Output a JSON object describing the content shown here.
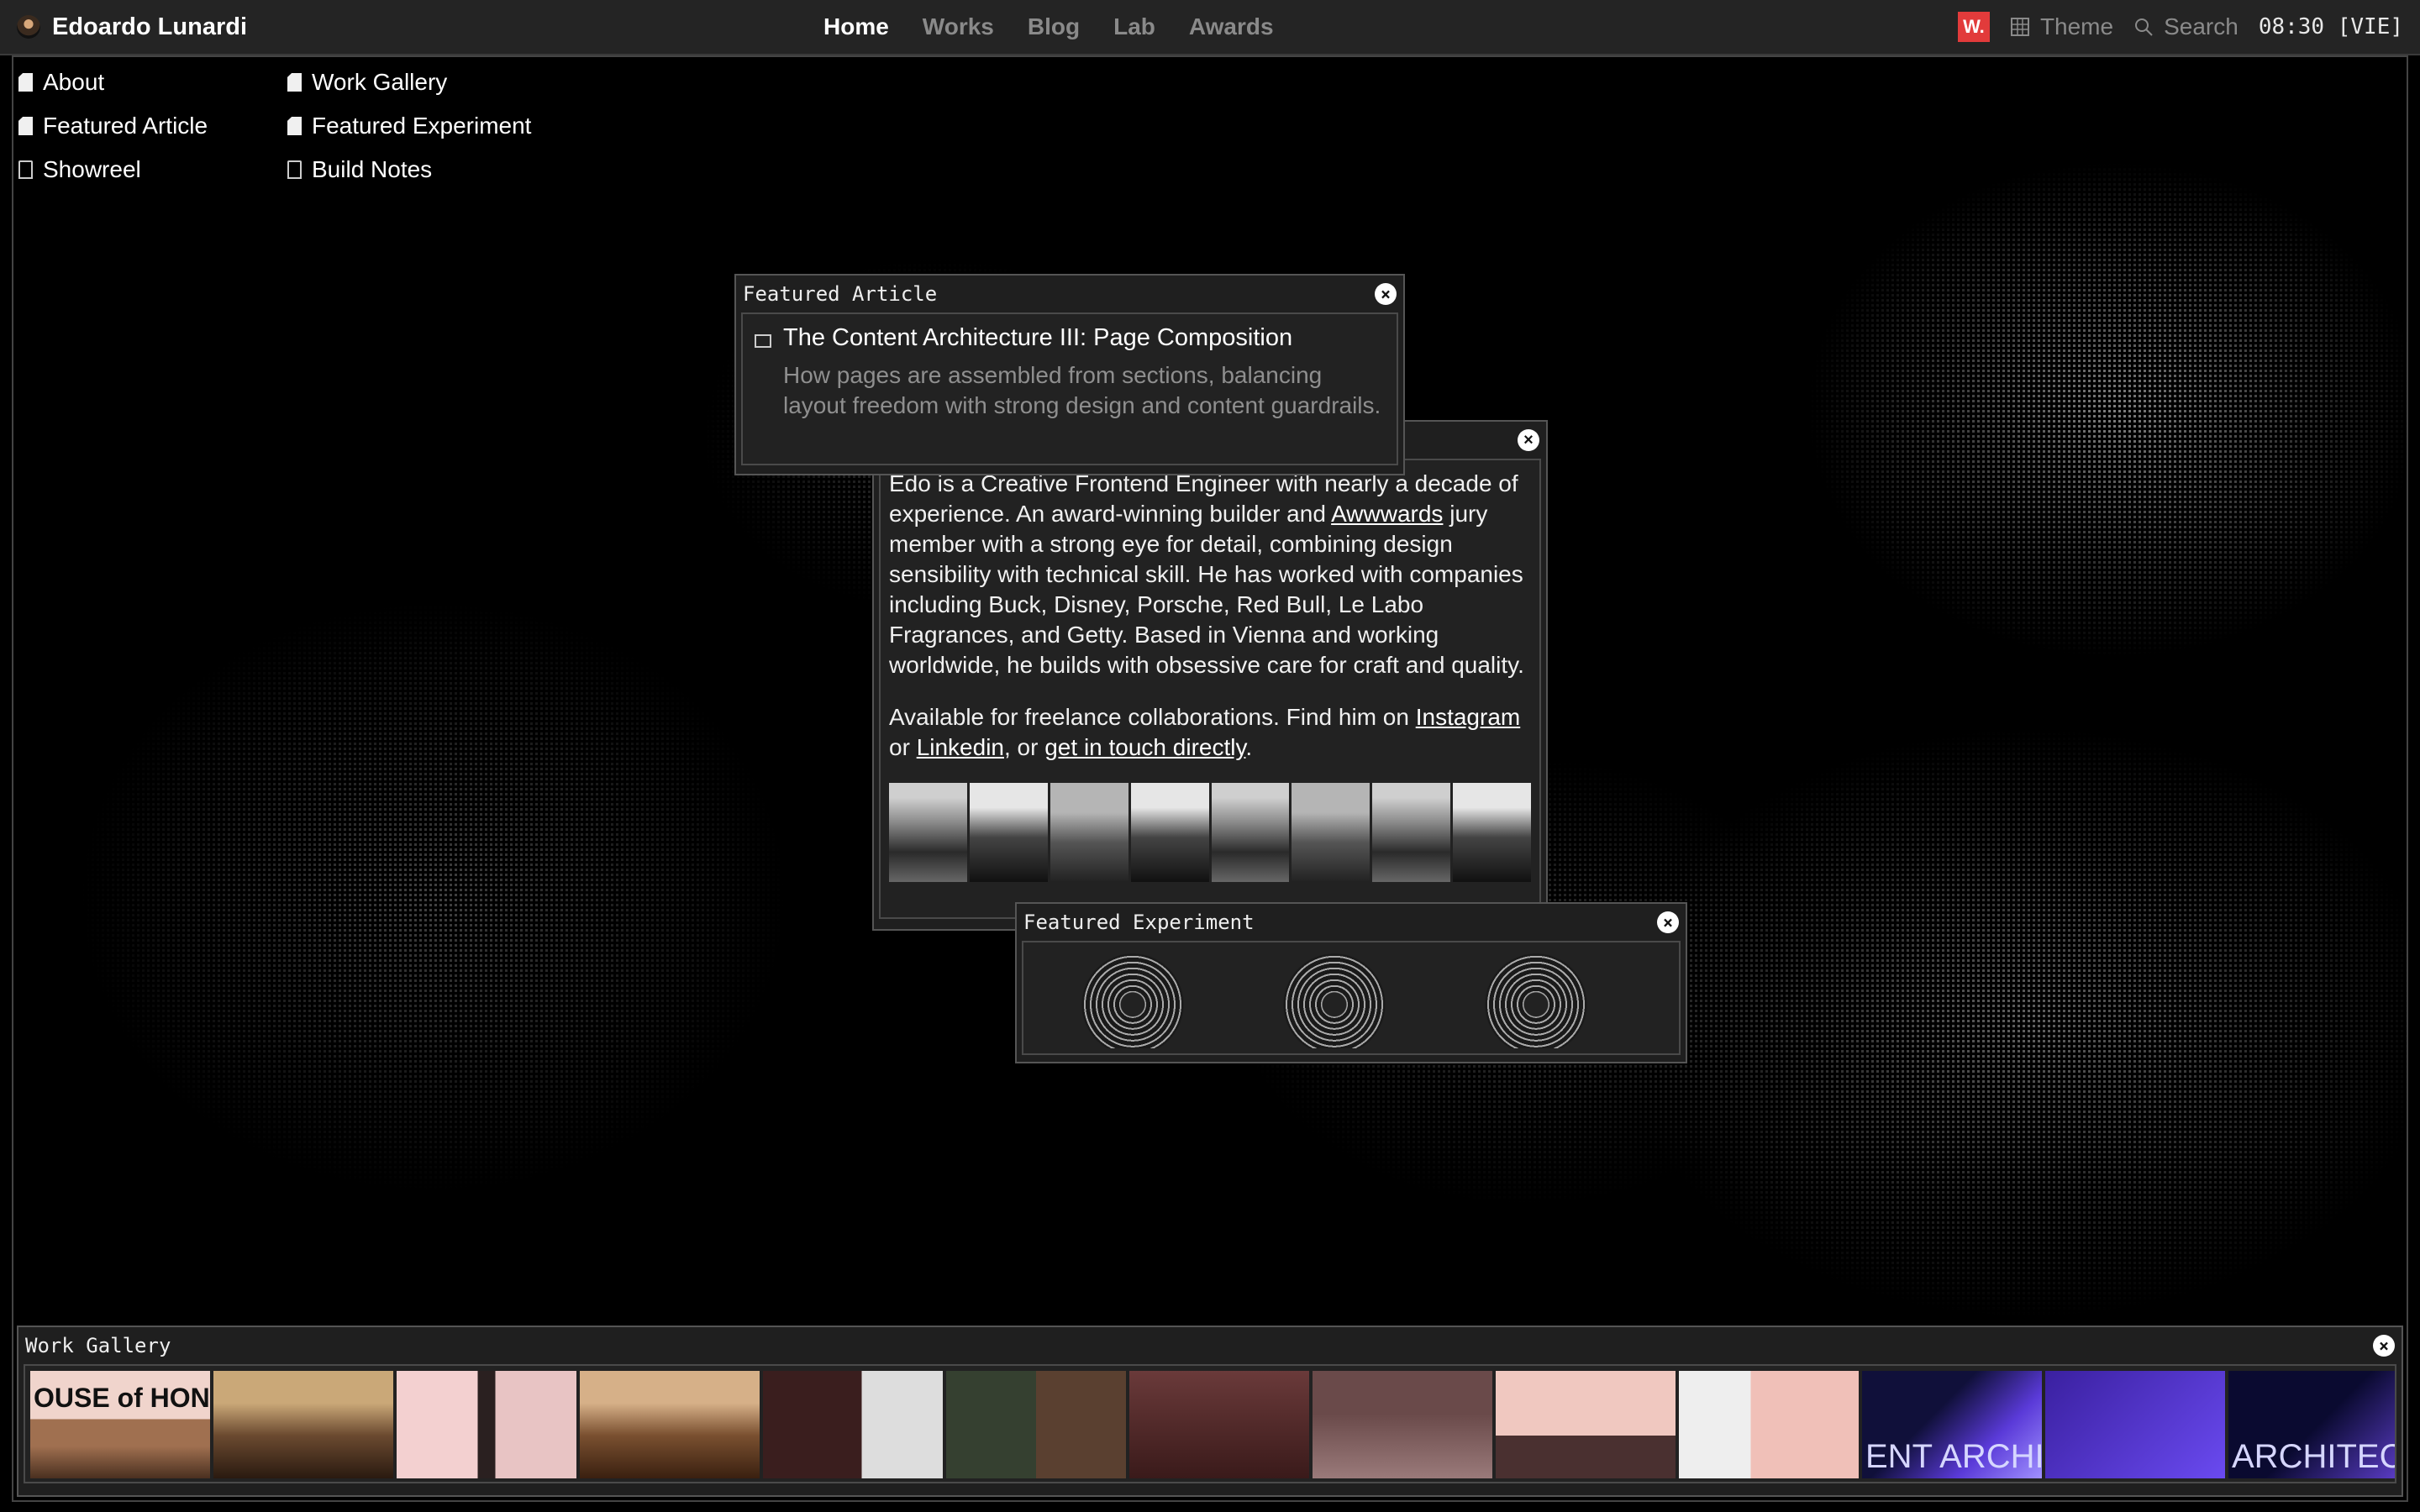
{
  "header": {
    "brand": "Edoardo Lunardi",
    "nav": [
      "Home",
      "Works",
      "Blog",
      "Lab",
      "Awards"
    ],
    "active_nav": "Home",
    "badge": "W.",
    "theme_label": "Theme",
    "search_label": "Search",
    "clock": "08:30 [VIE]"
  },
  "desktop_icons": [
    {
      "label": "About",
      "icon": "file-icon"
    },
    {
      "label": "Work Gallery",
      "icon": "file-icon"
    },
    {
      "label": "Featured Article",
      "icon": "file-icon"
    },
    {
      "label": "Featured Experiment",
      "icon": "file-icon"
    },
    {
      "label": "Showreel",
      "icon": "file-outline-icon"
    },
    {
      "label": "Build Notes",
      "icon": "file-outline-icon"
    }
  ],
  "article_window": {
    "title": "Featured Article",
    "heading": "The Content Architecture III: Page Composition",
    "description": "How pages are assembled from sections, balancing layout freedom with strong design and content guardrails."
  },
  "about_window": {
    "p1_a": "Edo is a Creative Frontend Engineer with nearly a decade of experience. An award-winning builder and ",
    "p1_link": "Awwwards",
    "p1_b": " jury member with a strong eye for detail, combining design sensibility with technical skill. He has worked with companies including Buck, Disney, Porsche, Red Bull, Le Labo Fragrances, and Getty. Based in Vienna and working worldwide, he builds with obsessive care for craft and quality.",
    "p2_a": "Available for freelance collaborations. Find him on ",
    "p2_link1": "Instagram",
    "p2_or": " or ",
    "p2_link2": "Linkedin",
    "p2_c": ", or ",
    "p2_link3": "get in touch directly",
    "p2_end": "."
  },
  "experiment_window": {
    "title": "Featured Experiment"
  },
  "gallery_window": {
    "title": "Work Gallery",
    "thumb_texts": [
      "OUSE of HONEY",
      "ENT ARCHI",
      "ARCHITECURE TH"
    ]
  },
  "colors": {
    "badge": "#e23b3b",
    "bar": "#242424",
    "window": "#1f1f1f"
  }
}
